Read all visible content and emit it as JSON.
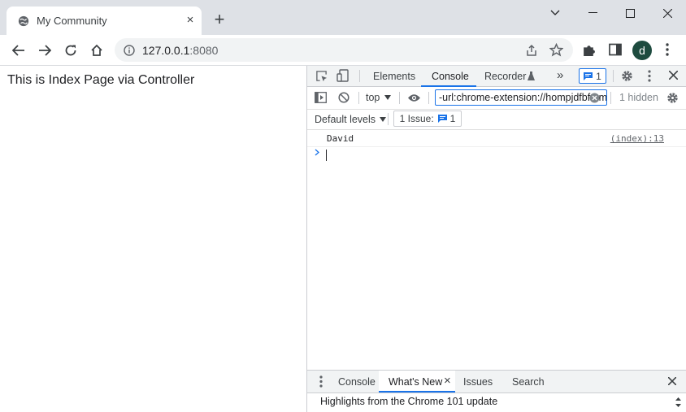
{
  "browser": {
    "tab": {
      "title": "My Community",
      "close_glyph": "×"
    },
    "new_tab_glyph": "+",
    "window_controls": {
      "chevron": "⌄"
    },
    "address": {
      "host": "127.0.0.1",
      "port": ":8080"
    },
    "profile_initial": "d"
  },
  "page": {
    "text": "This is Index Page via Controller"
  },
  "devtools": {
    "tabs": [
      "Elements",
      "Console",
      "Recorder"
    ],
    "active_tab": "Console",
    "more_tabs_glyph": "»",
    "issues_badge_count": "1",
    "console_toolbar": {
      "context": "top",
      "filter_value": "-url:chrome-extension://hompjdfbfmmmgflfjdlnkohcplmboaeo",
      "hidden_count": "1 hidden"
    },
    "levels": {
      "label": "Default levels",
      "issue_label": "1 Issue:",
      "issue_count": "1"
    },
    "log": {
      "message": "David",
      "source": "(index):13"
    },
    "drawer": {
      "tabs": [
        "Console",
        "What's New",
        "Issues",
        "Search"
      ],
      "active_tab": "What's New",
      "close_glyph": "×",
      "content_title": "Highlights from the Chrome 101 update"
    }
  },
  "colors": {
    "accent": "#1a73e8",
    "tabstrip": "#dee1e6",
    "avatar": "#1e4b3f"
  }
}
